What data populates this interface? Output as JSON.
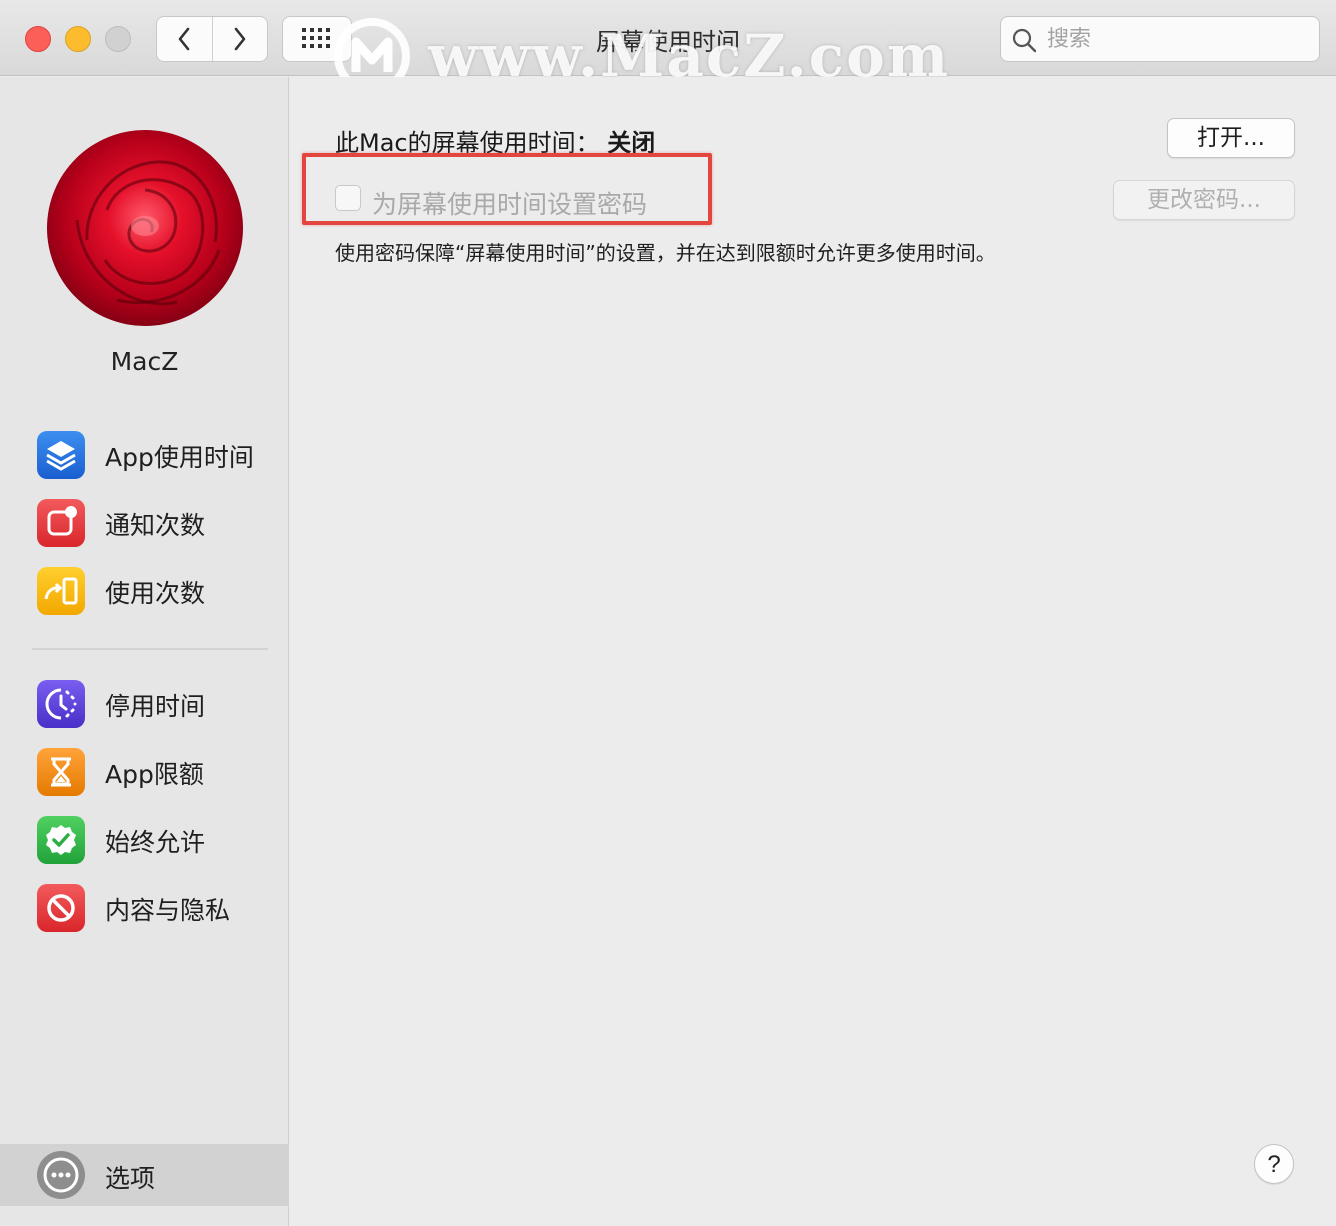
{
  "window": {
    "title": "屏幕使用时间",
    "search_placeholder": "搜索"
  },
  "watermark": {
    "text": "www.MacZ.com"
  },
  "sidebar": {
    "user_name": "MacZ",
    "groups": [
      [
        {
          "label": "App使用时间",
          "icon": "app-usage-icon",
          "color": "#1a73e8"
        },
        {
          "label": "通知次数",
          "icon": "notifications-icon",
          "color": "#e5383b"
        },
        {
          "label": "使用次数",
          "icon": "pickups-icon",
          "color": "#f5b400"
        }
      ],
      [
        {
          "label": "停用时间",
          "icon": "downtime-icon",
          "color": "#5b3fd6"
        },
        {
          "label": "App限额",
          "icon": "app-limits-icon",
          "color": "#f08c12"
        },
        {
          "label": "始终允许",
          "icon": "always-allowed-icon",
          "color": "#32b34b"
        },
        {
          "label": "内容与隐私",
          "icon": "content-privacy-icon",
          "color": "#e5383b"
        }
      ]
    ],
    "options_label": "选项"
  },
  "main": {
    "status_prefix": "此Mac的屏幕使用时间：",
    "status_value": "关闭",
    "open_button": "打开...",
    "passcode_checkbox_label": "为屏幕使用时间设置密码",
    "passcode_checked": false,
    "change_passcode_button": "更改密码...",
    "description": "使用密码保障“屏幕使用时间”的设置，并在达到限额时允许更多使用时间。",
    "help_button": "?"
  },
  "colors": {
    "highlight_box": "#e2463f",
    "traffic_close": "#fc5f57",
    "traffic_minimize": "#fdbc2e",
    "traffic_zoom_disabled": "#d1d1d1"
  }
}
